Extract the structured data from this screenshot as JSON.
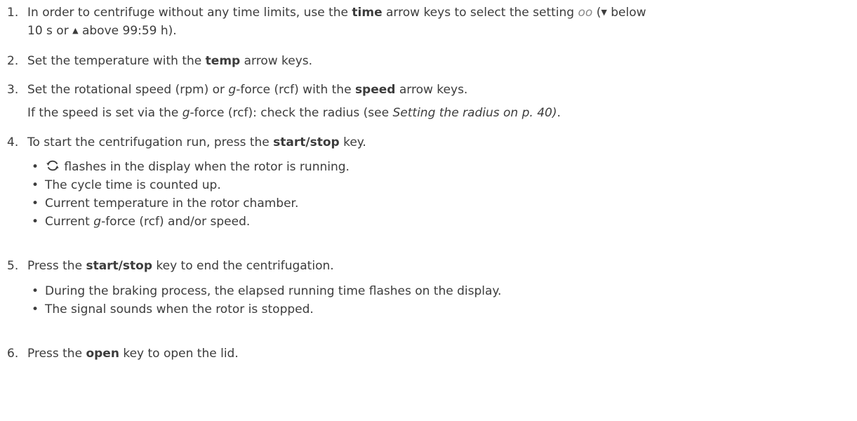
{
  "steps": [
    {
      "num": "1.",
      "parts": {
        "a": "In order to centrifuge without any time limits, use the ",
        "b": "time",
        "c": " arrow keys to select the setting ",
        "d": "oo",
        "e": " (",
        "f": "▼",
        "g": " below",
        "h": "10 s or ",
        "i": "▲",
        "j": " above 99:59 h)."
      }
    },
    {
      "num": "2.",
      "parts": {
        "a": "Set the temperature with the ",
        "b": "temp",
        "c": " arrow keys."
      }
    },
    {
      "num": "3.",
      "parts": {
        "a": "Set the rotational speed (rpm) or ",
        "b": "g",
        "c": "-force (rcf) with the ",
        "d": "speed",
        "e": " arrow keys."
      },
      "note": {
        "a": "If the speed is set via the ",
        "b": "g",
        "c": "-force (rcf): check the radius (see ",
        "d": "Setting the radius on p. 40)",
        "e": "."
      }
    },
    {
      "num": "4.",
      "parts": {
        "a": "To start the centrifugation run, press the ",
        "b": "start/stop",
        "c": " key."
      },
      "bullets": [
        {
          "text": " flashes in the display when the rotor is running."
        },
        {
          "text": "The cycle time is counted up."
        },
        {
          "text": "Current temperature in the rotor chamber."
        },
        {
          "a": "Current ",
          "b": "g",
          "c": "-force (rcf) and/or speed."
        }
      ]
    },
    {
      "num": "5.",
      "parts": {
        "a": "Press the ",
        "b": "start/stop",
        "c": " key to end the centrifugation."
      },
      "bullets": [
        {
          "text": "During the braking process, the elapsed running time flashes on the display."
        },
        {
          "text": "The signal sounds when the rotor is stopped."
        }
      ]
    },
    {
      "num": "6.",
      "parts": {
        "a": "Press the ",
        "b": "open",
        "c": " key to open the lid."
      }
    }
  ],
  "bullet_char": "•",
  "icons": {
    "rotor": "rotor-running-icon"
  },
  "colors": {
    "text": "#3c3c3c",
    "setting": "#888888"
  }
}
